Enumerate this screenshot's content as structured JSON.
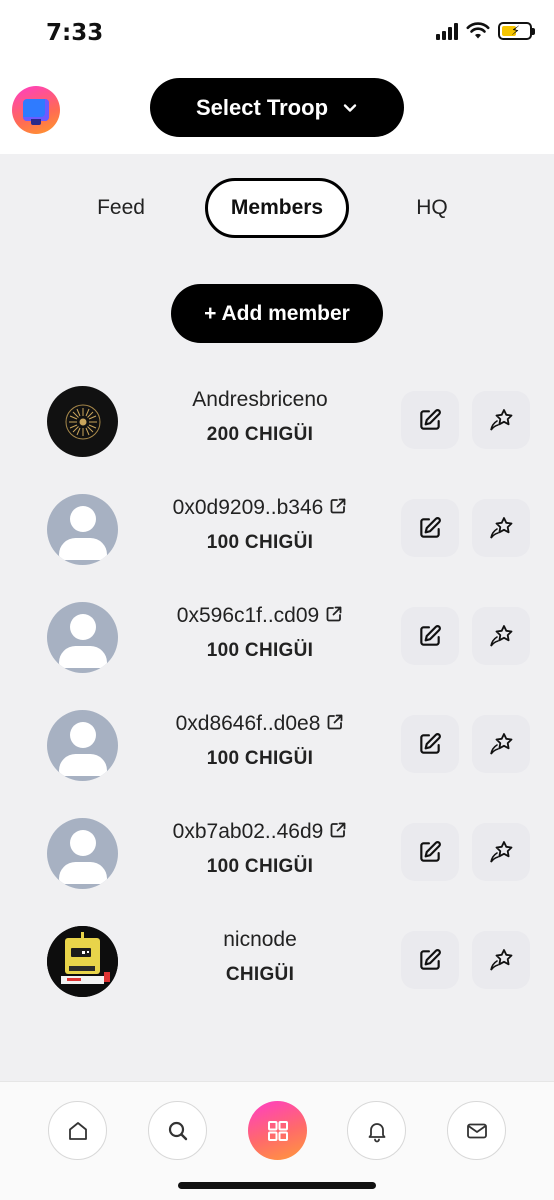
{
  "status_bar": {
    "time": "7:33"
  },
  "header": {
    "troop_selector_label": "Select Troop"
  },
  "tabs": [
    {
      "label": "Feed",
      "active": false
    },
    {
      "label": "Members",
      "active": true
    },
    {
      "label": "HQ",
      "active": false
    }
  ],
  "add_member_label": "+ Add member",
  "members": [
    {
      "name": "Andresbriceno",
      "balance": "200 CHIGÜI",
      "avatar": "sun-avatar",
      "external_link": false
    },
    {
      "name": "0x0d9209..b346",
      "balance": "100 CHIGÜI",
      "avatar": "default-avatar",
      "external_link": true
    },
    {
      "name": "0x596c1f..cd09",
      "balance": "100 CHIGÜI",
      "avatar": "default-avatar",
      "external_link": true
    },
    {
      "name": "0xd8646f..d0e8",
      "balance": "100 CHIGÜI",
      "avatar": "default-avatar",
      "external_link": true
    },
    {
      "name": "0xb7ab02..46d9",
      "balance": "100 CHIGÜI",
      "avatar": "default-avatar",
      "external_link": true
    },
    {
      "name": "nicnode",
      "balance": "CHIGÜI",
      "avatar": "robot-avatar",
      "external_link": false
    }
  ],
  "icons": {
    "edit": "edit-icon",
    "star": "shooting-star-icon",
    "external": "external-link-icon"
  },
  "bottom_nav": [
    "home-icon",
    "search-icon",
    "apps-icon",
    "bell-icon",
    "mail-icon"
  ],
  "colors": {
    "primary_button": "#000000",
    "content_background": "#f0f0f2",
    "default_avatar": "#a7b1c2",
    "accent_gradient_start": "#ff3cc7",
    "accent_gradient_end": "#ff9a3a"
  }
}
